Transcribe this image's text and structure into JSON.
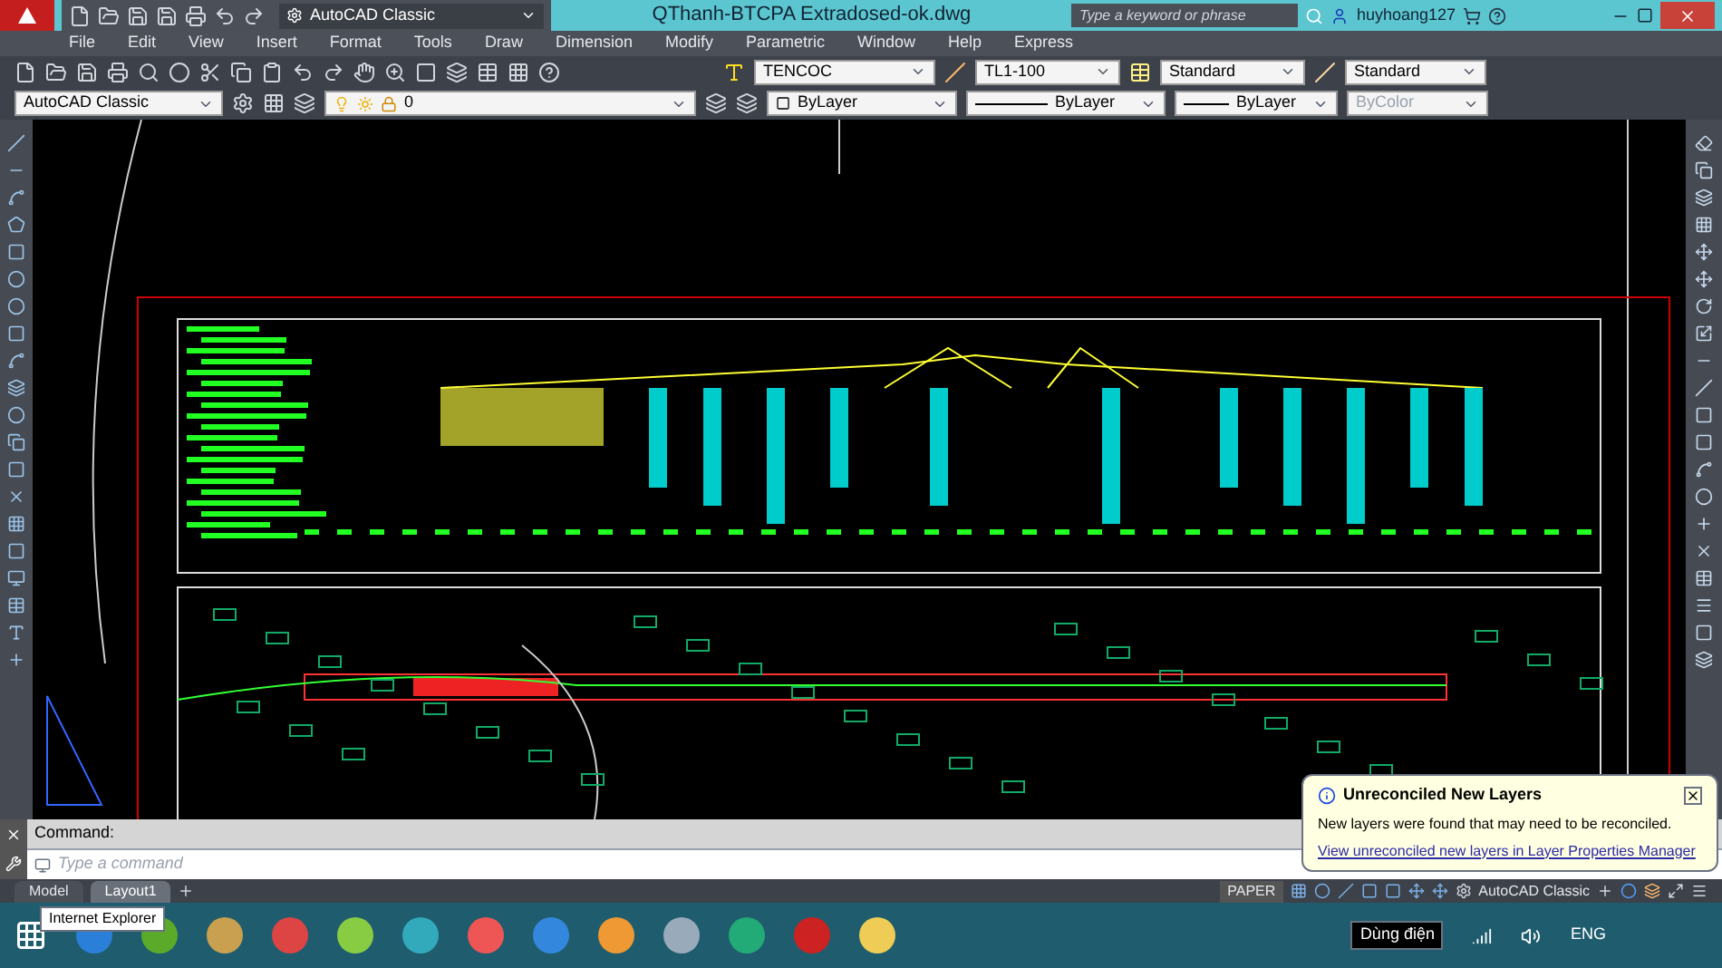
{
  "app": {
    "workspace": "AutoCAD Classic",
    "title": "QThanh-BTCPA Extradosed-ok.dwg",
    "search": {
      "placeholder": "Type a keyword or phrase"
    },
    "user": "huyhoang127"
  },
  "menu": [
    "File",
    "Edit",
    "View",
    "Insert",
    "Format",
    "Tools",
    "Draw",
    "Dimension",
    "Modify",
    "Parametric",
    "Window",
    "Help",
    "Express"
  ],
  "style_toolbar": {
    "dropdowns": [
      "TENCOC",
      "TL1-100",
      "Standard",
      "Standard"
    ]
  },
  "properties_toolbar": {
    "workspace": "AutoCAD Classic",
    "layer": "0",
    "controls": [
      {
        "kind": "swatch",
        "value": "ByLayer",
        "disabled": false
      },
      {
        "kind": "linetype",
        "value": "ByLayer",
        "disabled": false
      },
      {
        "kind": "lineweight",
        "value": "ByLayer",
        "disabled": false
      },
      {
        "kind": "plotstyle",
        "value": "ByColor",
        "disabled": true
      }
    ]
  },
  "command_line": {
    "history": "Command:",
    "placeholder": "Type a command"
  },
  "layout_tabs": [
    {
      "label": "Model",
      "selected": false
    },
    {
      "label": "Layout1",
      "selected": true
    }
  ],
  "tooltip": "Internet Explorer",
  "status_bar": {
    "space": "PAPER",
    "workspace": "AutoCAD Classic"
  },
  "notification": {
    "title": "Unreconciled New Layers",
    "message": "New layers were found that may need to be reconciled.",
    "link": "View unreconciled new layers in Layer Properties Manager"
  },
  "taskbar": {
    "tooltip": "Dùng điện",
    "language": "ENG"
  }
}
